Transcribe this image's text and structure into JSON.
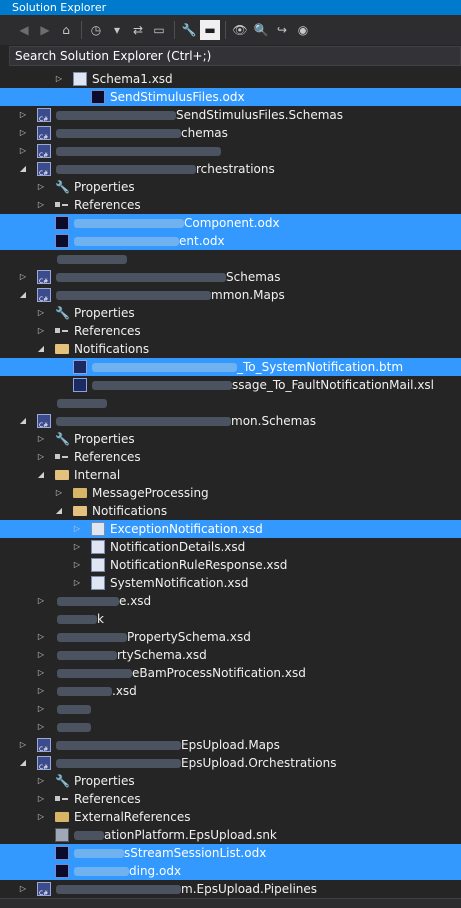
{
  "panel": {
    "title": "Solution Explorer"
  },
  "toolbar": {
    "buttons": [
      {
        "name": "back-icon",
        "glyph": "◀",
        "dim": true
      },
      {
        "name": "forward-icon",
        "glyph": "▶",
        "dim": true
      },
      {
        "name": "home-icon",
        "glyph": "⌂"
      },
      {
        "name": "pending-changes-filter-icon",
        "glyph": "◷"
      },
      {
        "name": "dropdown-chevron-icon",
        "glyph": "▾"
      },
      {
        "name": "sync-with-document-icon",
        "glyph": "⇄"
      },
      {
        "name": "collapse-all-icon",
        "glyph": "▭"
      },
      {
        "name": "properties-wrench-icon",
        "glyph": "🔧"
      },
      {
        "name": "show-all-files-icon",
        "glyph": "▬",
        "pressed": true
      },
      {
        "name": "preview-selected-items-icon",
        "glyph": "👁"
      },
      {
        "name": "view-class-diagram-icon",
        "glyph": "🔍"
      },
      {
        "name": "open-folder-icon",
        "glyph": "↪"
      },
      {
        "name": "refresh-icon",
        "glyph": "◉"
      }
    ]
  },
  "search": {
    "placeholder": "Search Solution Explorer (Ctrl+;)"
  },
  "tree": [
    {
      "indent": 2,
      "arrow": "right",
      "icon": "xsd",
      "label": "Schema1.xsd"
    },
    {
      "indent": 3,
      "arrow": "",
      "icon": "odx",
      "label": "SendStimulusFiles.odx",
      "selected": true
    },
    {
      "indent": 0,
      "arrow": "right",
      "icon": "proj",
      "blur": 120,
      "label": "SendStimulusFiles.Schemas"
    },
    {
      "indent": 0,
      "arrow": "right",
      "icon": "proj",
      "blur": 125,
      "label": "chemas"
    },
    {
      "indent": 0,
      "arrow": "right",
      "icon": "proj",
      "blur": 165,
      "label": ""
    },
    {
      "indent": 0,
      "arrow": "down",
      "icon": "proj",
      "blur": 140,
      "label": "rchestrations"
    },
    {
      "indent": 1,
      "arrow": "right",
      "icon": "wrench",
      "label": "Properties"
    },
    {
      "indent": 1,
      "arrow": "right",
      "icon": "ref",
      "label": "References"
    },
    {
      "indent": 1,
      "arrow": "",
      "icon": "odx",
      "blur": 110,
      "label": "Component.odx",
      "selected": true
    },
    {
      "indent": 1,
      "arrow": "",
      "icon": "odx",
      "blur": 105,
      "label": "ent.odx",
      "selected": true
    },
    {
      "indent": 1,
      "arrow": "",
      "icon": "",
      "blur": 70,
      "label": ""
    },
    {
      "indent": 0,
      "arrow": "right",
      "icon": "proj",
      "blur": 170,
      "label": "Schemas"
    },
    {
      "indent": 0,
      "arrow": "down",
      "icon": "proj",
      "blur": 155,
      "label": "mmon.Maps"
    },
    {
      "indent": 1,
      "arrow": "right",
      "icon": "wrench",
      "label": "Properties"
    },
    {
      "indent": 1,
      "arrow": "right",
      "icon": "ref",
      "label": "References"
    },
    {
      "indent": 1,
      "arrow": "down",
      "icon": "folder-open",
      "label": "Notifications"
    },
    {
      "indent": 2,
      "arrow": "",
      "icon": "btm",
      "blur": 145,
      "label": "_To_SystemNotification.btm",
      "selected": true
    },
    {
      "indent": 2,
      "arrow": "",
      "icon": "btm",
      "blur": 140,
      "label": "ssage_To_FaultNotificationMail.xsl"
    },
    {
      "indent": 1,
      "arrow": "",
      "icon": "",
      "blur": 50,
      "label": ""
    },
    {
      "indent": 0,
      "arrow": "down",
      "icon": "proj",
      "blur": 175,
      "label": "mon.Schemas"
    },
    {
      "indent": 1,
      "arrow": "right",
      "icon": "wrench",
      "label": "Properties"
    },
    {
      "indent": 1,
      "arrow": "right",
      "icon": "ref",
      "label": "References"
    },
    {
      "indent": 1,
      "arrow": "down",
      "icon": "folder-open",
      "label": "Internal"
    },
    {
      "indent": 2,
      "arrow": "right",
      "icon": "folder",
      "label": "MessageProcessing"
    },
    {
      "indent": 2,
      "arrow": "down",
      "icon": "folder-open",
      "label": "Notifications"
    },
    {
      "indent": 3,
      "arrow": "right",
      "icon": "xsd",
      "label": "ExceptionNotification.xsd",
      "selected": true
    },
    {
      "indent": 3,
      "arrow": "right",
      "icon": "xsd",
      "label": "NotificationDetails.xsd"
    },
    {
      "indent": 3,
      "arrow": "right",
      "icon": "xsd",
      "label": "NotificationRuleResponse.xsd"
    },
    {
      "indent": 3,
      "arrow": "right",
      "icon": "xsd",
      "label": "SystemNotification.xsd"
    },
    {
      "indent": 1,
      "arrow": "right",
      "icon": "",
      "blur": 62,
      "label": "e.xsd"
    },
    {
      "indent": 1,
      "arrow": "",
      "icon": "",
      "blur": 40,
      "label": "k"
    },
    {
      "indent": 1,
      "arrow": "right",
      "icon": "",
      "blur": 70,
      "label": "PropertySchema.xsd"
    },
    {
      "indent": 1,
      "arrow": "right",
      "icon": "",
      "blur": 60,
      "label": "rtySchema.xsd"
    },
    {
      "indent": 1,
      "arrow": "right",
      "icon": "",
      "blur": 75,
      "label": "eBamProcessNotification.xsd"
    },
    {
      "indent": 1,
      "arrow": "right",
      "icon": "",
      "blur": 55,
      "label": ".xsd"
    },
    {
      "indent": 1,
      "arrow": "right",
      "icon": "",
      "blur": 34,
      "label": ""
    },
    {
      "indent": 1,
      "arrow": "right",
      "icon": "",
      "blur": 34,
      "label": ""
    },
    {
      "indent": 0,
      "arrow": "right",
      "icon": "proj",
      "blur": 125,
      "label": "EpsUpload.Maps"
    },
    {
      "indent": 0,
      "arrow": "down",
      "icon": "proj",
      "blur": 125,
      "label": "EpsUpload.Orchestrations"
    },
    {
      "indent": 1,
      "arrow": "right",
      "icon": "wrench",
      "label": "Properties"
    },
    {
      "indent": 1,
      "arrow": "right",
      "icon": "ref",
      "label": "References"
    },
    {
      "indent": 1,
      "arrow": "right",
      "icon": "folder",
      "label": "ExternalReferences"
    },
    {
      "indent": 1,
      "arrow": "",
      "icon": "snk",
      "blur": 30,
      "label": "ationPlatform.EpsUpload.snk"
    },
    {
      "indent": 1,
      "arrow": "",
      "icon": "odx",
      "blur": 50,
      "label": "sStreamSessionList.odx",
      "selected": true
    },
    {
      "indent": 1,
      "arrow": "",
      "icon": "odx",
      "blur": 55,
      "label": "ding.odx",
      "selected": true
    },
    {
      "indent": 0,
      "arrow": "right",
      "icon": "proj",
      "blur": 125,
      "label": "m.EpsUpload.Pipelines"
    }
  ]
}
